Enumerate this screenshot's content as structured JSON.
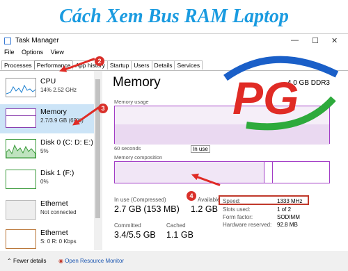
{
  "headline": "Cách Xem Bus RAM Laptop",
  "window": {
    "title": "Task Manager"
  },
  "menu": [
    "File",
    "Options",
    "View"
  ],
  "tabs": [
    "Processes",
    "Performance",
    "App history",
    "Startup",
    "Users",
    "Details",
    "Services"
  ],
  "sidebar": [
    {
      "name": "CPU",
      "sub": "14% 2.52 GHz"
    },
    {
      "name": "Memory",
      "sub": "2.7/3.9 GB (69%)"
    },
    {
      "name": "Disk 0 (C: D: E:)",
      "sub": "5%"
    },
    {
      "name": "Disk 1 (F:)",
      "sub": "0%"
    },
    {
      "name": "Ethernet",
      "sub": "Not connected"
    },
    {
      "name": "Ethernet",
      "sub": "S: 0 R: 0 Kbps"
    }
  ],
  "panel": {
    "title": "Memory",
    "capacity": "4.0 GB DDR3",
    "usage_label": "Memory usage",
    "seconds_label": "60 seconds",
    "inuse_tooltip": "In use",
    "composition_label": "Memory composition",
    "stats": [
      {
        "label": "In use (Compressed)",
        "value": "2.7 GB (153 MB)"
      },
      {
        "label": "Available",
        "value": "1.2 GB"
      },
      {
        "label": "Committed",
        "value": "3.4/5.5 GB"
      },
      {
        "label": "Cached",
        "value": "1.1 GB"
      }
    ],
    "details": [
      {
        "key": "Speed:",
        "value": "1333 MHz"
      },
      {
        "key": "Slots used:",
        "value": "1 of 2"
      },
      {
        "key": "Form factor:",
        "value": "SODIMM"
      },
      {
        "key": "Hardware reserved:",
        "value": "92.8 MB"
      }
    ]
  },
  "footer": {
    "fewer": "Fewer details",
    "monitor": "Open Resource Monitor"
  },
  "badges": [
    "2",
    "3",
    "4"
  ],
  "logo": {
    "text": "PG",
    "colors": {
      "blue": "#1a5fc8",
      "red": "#e02b25",
      "green": "#2eaa3c"
    }
  }
}
